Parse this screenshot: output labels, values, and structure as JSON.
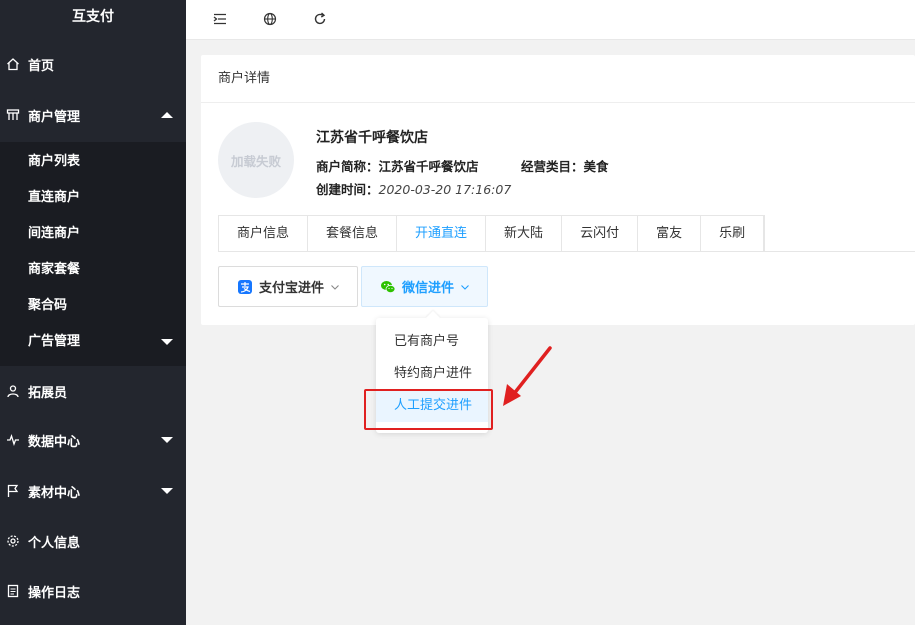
{
  "sidebar": {
    "brand": "互支付",
    "items": [
      {
        "label": "首页",
        "icon": "home-icon"
      },
      {
        "label": "商户管理",
        "icon": "merchant-icon",
        "expanded": true
      },
      {
        "label": "拓展员",
        "icon": "person-icon"
      },
      {
        "label": "数据中心",
        "icon": "pulse-icon"
      },
      {
        "label": "素材中心",
        "icon": "flag-icon"
      },
      {
        "label": "个人信息",
        "icon": "gear-icon"
      },
      {
        "label": "操作日志",
        "icon": "log-icon"
      }
    ],
    "sub_items": [
      "商户列表",
      "直连商户",
      "间连商户",
      "商家套餐",
      "聚合码",
      "广告管理"
    ]
  },
  "topbar": {
    "icons": [
      "menu-fold-icon",
      "globe-icon",
      "refresh-icon"
    ]
  },
  "card": {
    "title": "商户详情",
    "avatar_text": "加载失败",
    "merchant_name": "江苏省千呼餐饮店",
    "short_name_label": "商户简称：",
    "short_name_value": "江苏省千呼餐饮店",
    "category_label": "经营类目：",
    "category_value": "美食",
    "created_label": "创建时间：",
    "created_value": "2020-03-20 17:16:07",
    "tabs": [
      "商户信息",
      "套餐信息",
      "开通直连",
      "新大陆",
      "云闪付",
      "富友",
      "乐刷"
    ],
    "active_tab": "开通直连",
    "alipay_button": "支付宝进件",
    "wechat_button": "微信进件"
  },
  "dropdown": {
    "items": [
      "已有商户号",
      "特约商户进件",
      "人工提交进件"
    ],
    "highlighted": "人工提交进件"
  },
  "colors": {
    "sidebar_bg": "#23262e",
    "submenu_bg": "#1a1c22",
    "accent": "#1e9fff",
    "annotation": "#e02020",
    "wechat_green": "#2dc100",
    "alipay_blue": "#1677ff"
  }
}
